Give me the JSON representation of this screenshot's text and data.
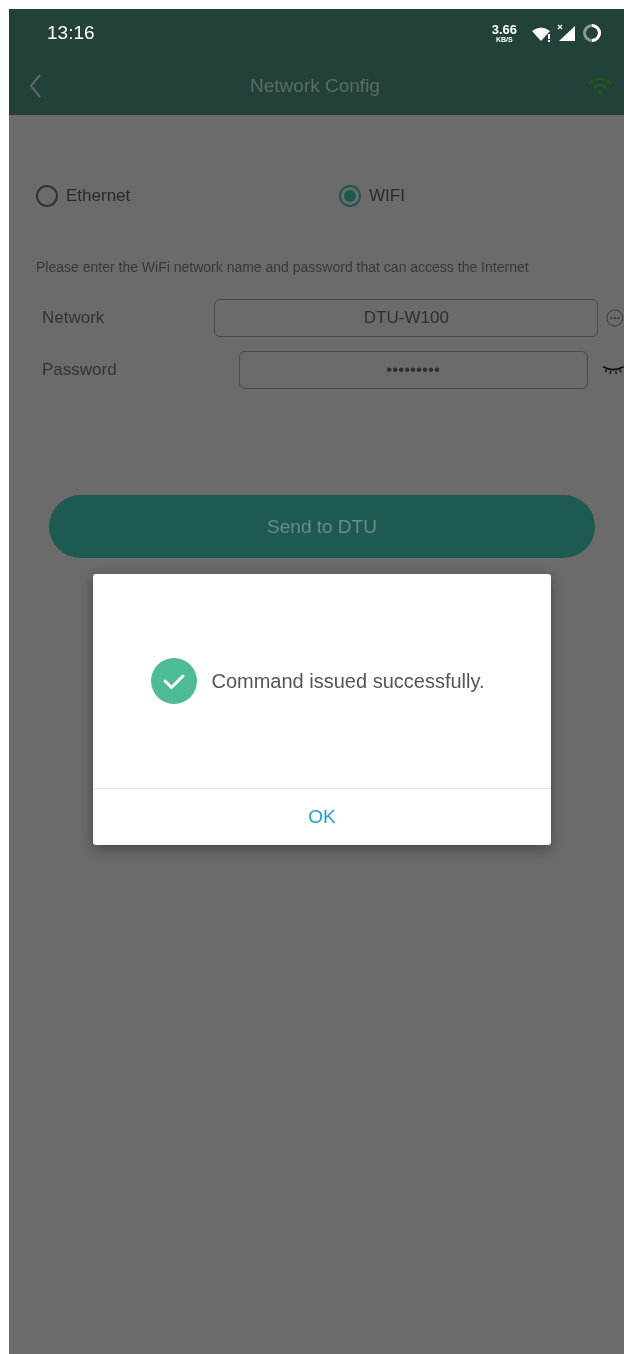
{
  "status_bar": {
    "time": "13:16",
    "speed": "3.66",
    "speed_unit": "KB/S"
  },
  "header": {
    "title": "Network Config"
  },
  "connection_types": [
    {
      "label": "Ethernet",
      "selected": false
    },
    {
      "label": "WIFI",
      "selected": true
    }
  ],
  "hint": "Please enter the WiFi network name and password that can access the Internet",
  "fields": [
    {
      "kind": "network",
      "label": "Network",
      "value": "DTU-W100"
    },
    {
      "kind": "password",
      "label": "Password",
      "value": "•••••••••"
    }
  ],
  "send_button": "Send to DTU",
  "dialog": {
    "message": "Command issued successfully.",
    "ok": "OK"
  }
}
